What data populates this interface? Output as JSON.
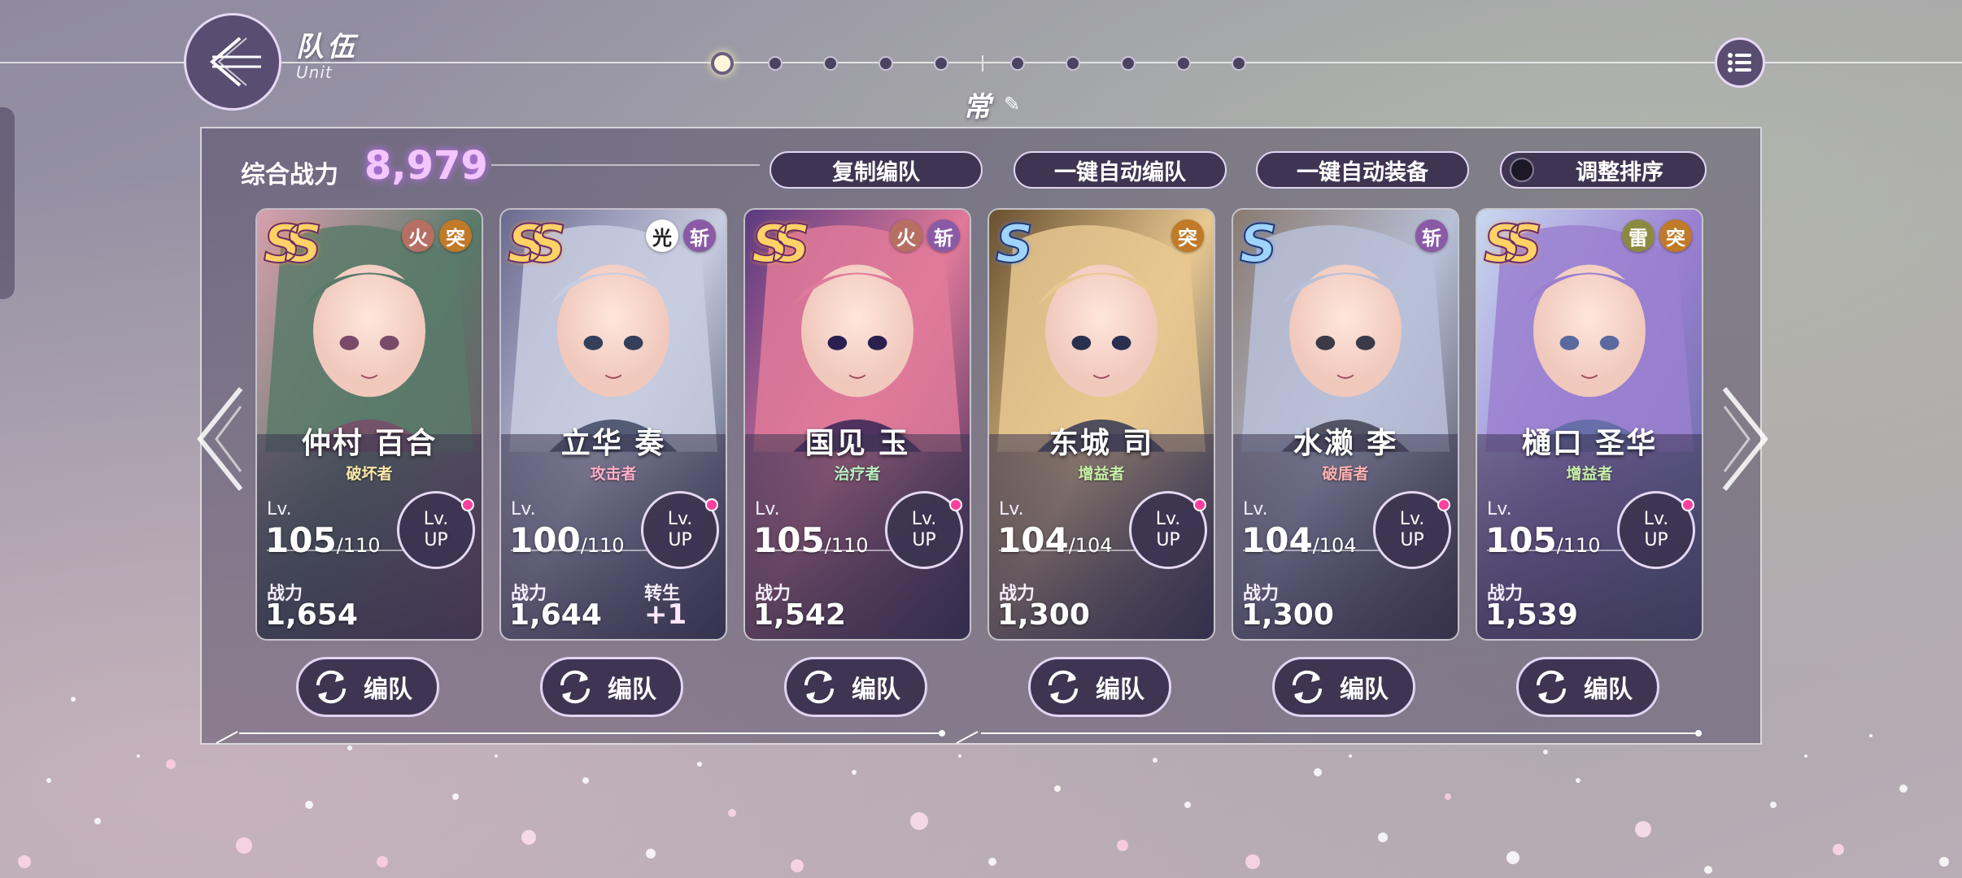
{
  "header": {
    "title": "队伍",
    "subtitle": "Unit",
    "team_name": "常"
  },
  "page_dots": {
    "count": 10,
    "active_index": 0
  },
  "summary": {
    "power_label": "综合战力",
    "power_value": "8,979"
  },
  "actions": {
    "copy": "复制编队",
    "auto_form": "一键自动编队",
    "auto_equip": "一键自动装备",
    "sort": "调整排序"
  },
  "cards": [
    {
      "name": "仲村 百合",
      "role": "破坏者",
      "role_color": "#ffe9a8",
      "rarity": "SS",
      "elements": [
        "火",
        "突"
      ],
      "lv": "105",
      "lv_max": "/110",
      "lv_up_line1": "Lv.",
      "lv_up_line2": "UP",
      "power_label": "战力",
      "power": "1,654",
      "rebirth_label": "",
      "rebirth": "",
      "edit_label": "编队",
      "colors": [
        "#5a7a6a",
        "#d8a0b0",
        "#7a4a6a"
      ]
    },
    {
      "name": "立华 奏",
      "role": "攻击者",
      "role_color": "#ffb0c8",
      "rarity": "SS",
      "elements": [
        "光",
        "斩"
      ],
      "lv": "100",
      "lv_max": "/110",
      "lv_up_line1": "Lv.",
      "lv_up_line2": "UP",
      "power_label": "战力",
      "power": "1,644",
      "rebirth_label": "转生",
      "rebirth": "+1",
      "edit_label": "编队",
      "colors": [
        "#c8cce0",
        "#6a6a90",
        "#34405a"
      ]
    },
    {
      "name": "国见 玉",
      "role": "治疗者",
      "role_color": "#b8f0c0",
      "rarity": "SS",
      "elements": [
        "火",
        "斩"
      ],
      "lv": "105",
      "lv_max": "/110",
      "lv_up_line1": "Lv.",
      "lv_up_line2": "UP",
      "power_label": "战力",
      "power": "1,542",
      "rebirth_label": "",
      "rebirth": "",
      "edit_label": "编队",
      "colors": [
        "#e07a9a",
        "#5a3a80",
        "#2a2050"
      ]
    },
    {
      "name": "东城 司",
      "role": "增益者",
      "role_color": "#c8f0a8",
      "rarity": "S",
      "elements": [
        "突"
      ],
      "lv": "104",
      "lv_max": "/104",
      "lv_up_line1": "Lv.",
      "lv_up_line2": "UP",
      "power_label": "战力",
      "power": "1,300",
      "rebirth_label": "",
      "rebirth": "",
      "edit_label": "编队",
      "colors": [
        "#e8c890",
        "#6a5030",
        "#2a3050"
      ]
    },
    {
      "name": "水濑 李",
      "role": "破盾者",
      "role_color": "#ffb0b0",
      "rarity": "S",
      "elements": [
        "斩"
      ],
      "lv": "104",
      "lv_max": "/104",
      "lv_up_line1": "Lv.",
      "lv_up_line2": "UP",
      "power_label": "战力",
      "power": "1,300",
      "rebirth_label": "",
      "rebirth": "",
      "edit_label": "编队",
      "colors": [
        "#b8c0d8",
        "#8a7a70",
        "#3a3a48"
      ]
    },
    {
      "name": "樋口 圣华",
      "role": "增益者",
      "role_color": "#c8f0a8",
      "rarity": "SS",
      "elements": [
        "雷",
        "突"
      ],
      "lv": "105",
      "lv_max": "/110",
      "lv_up_line1": "Lv.",
      "lv_up_line2": "UP",
      "power_label": "战力",
      "power": "1,539",
      "rebirth_label": "",
      "rebirth": "",
      "edit_label": "编队",
      "colors": [
        "#9a80d0",
        "#c8d8f0",
        "#5a6aa0"
      ]
    }
  ]
}
